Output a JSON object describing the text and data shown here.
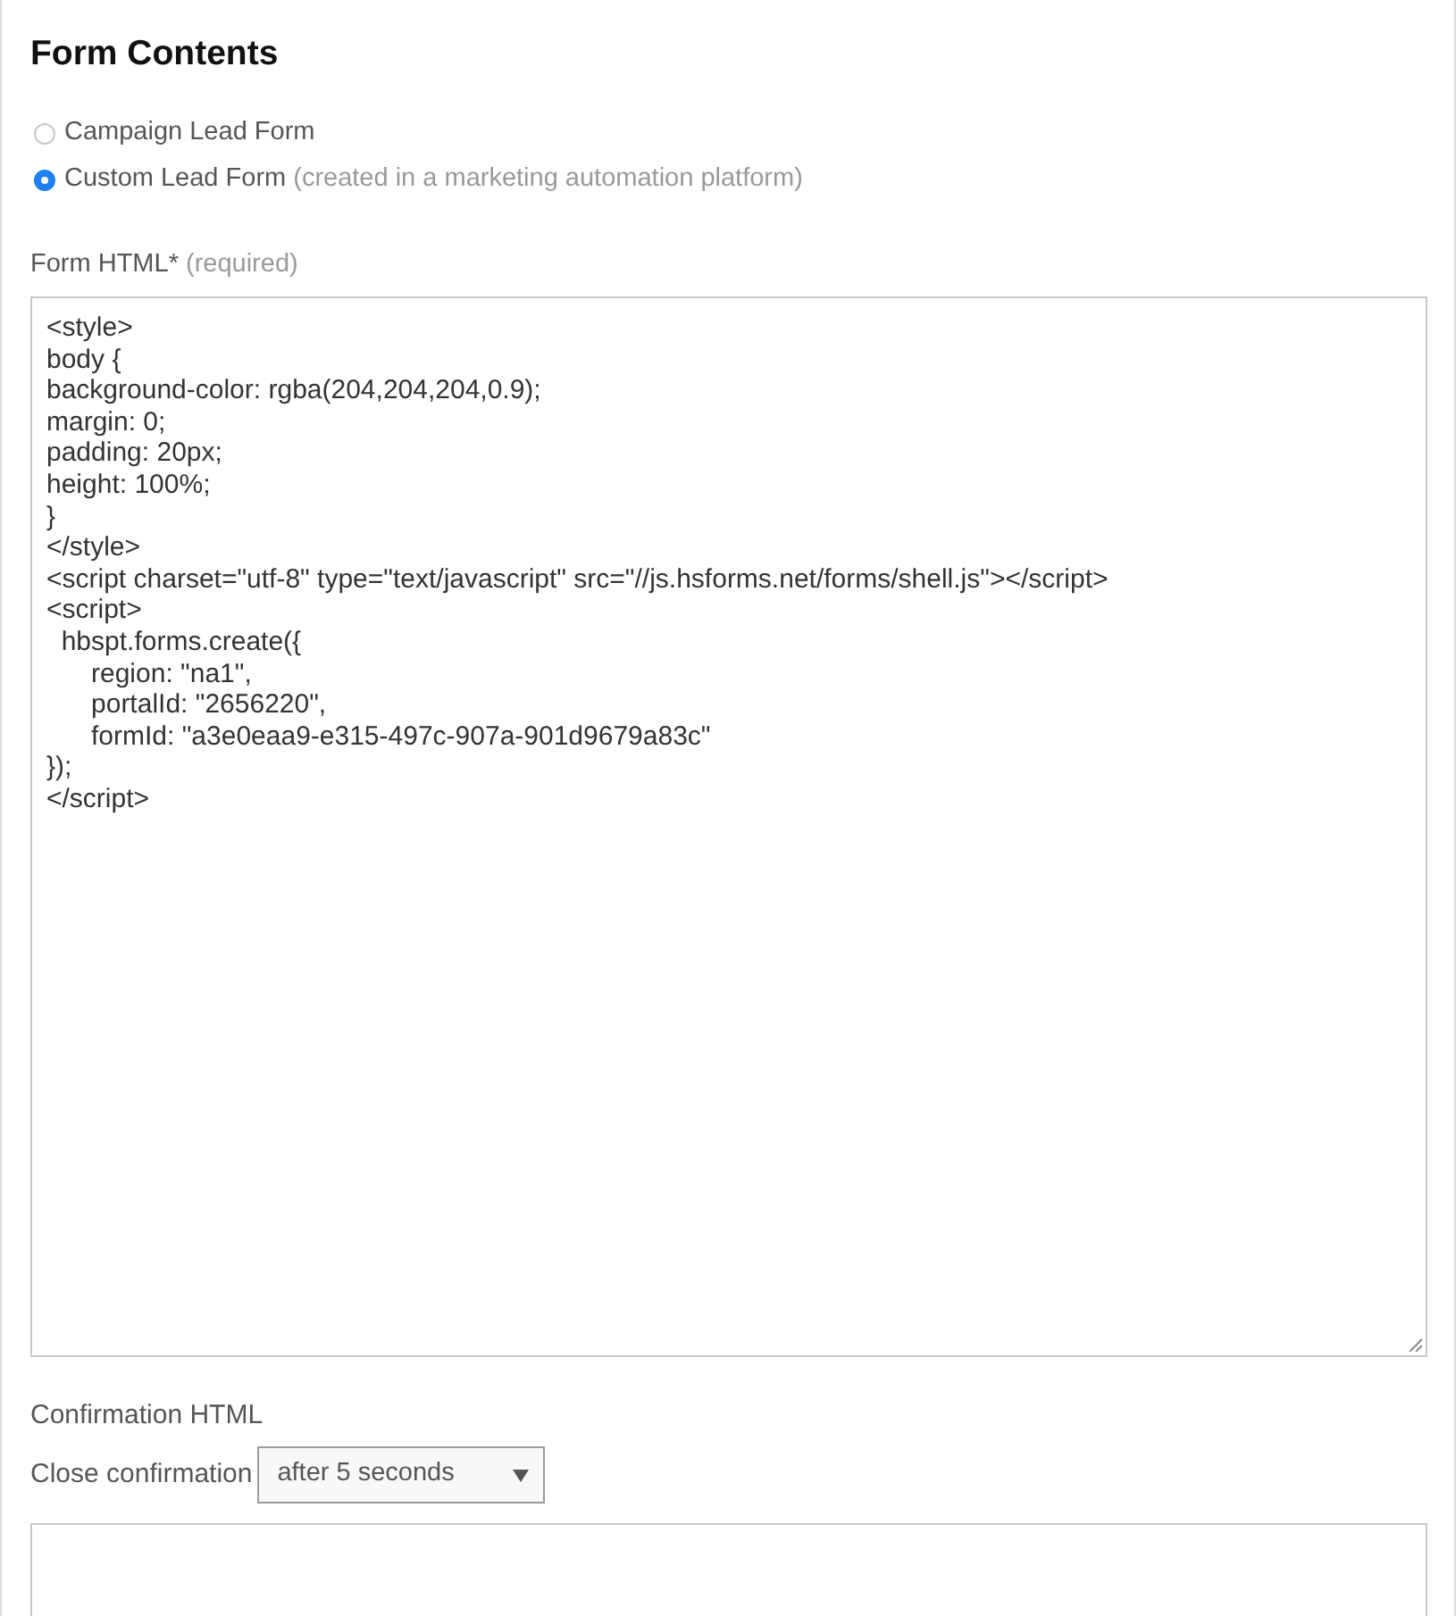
{
  "section": {
    "title": "Form Contents"
  },
  "form_type_options": [
    {
      "label": "Campaign Lead Form",
      "selected": false
    },
    {
      "label": "Custom Lead Form",
      "hint": "(created in a marketing automation platform)",
      "selected": true
    }
  ],
  "form_html": {
    "label": "Form HTML*",
    "hint": "(required)",
    "value": "<style>\nbody {\nbackground-color: rgba(204,204,204,0.9);\nmargin: 0;\npadding: 20px;\nheight: 100%;\n}\n</style>\n<script charset=\"utf-8\" type=\"text/javascript\" src=\"//js.hsforms.net/forms/shell.js\"></script>\n<script>\n  hbspt.forms.create({\n      region: \"na1\",\n      portalId: \"2656220\",\n      formId: \"a3e0eaa9-e315-497c-907a-901d9679a83c\"\n});\n</script>"
  },
  "confirmation_html": {
    "label": "Confirmation HTML",
    "close_confirmation": {
      "label": "Close confirmation",
      "value": "after 5 seconds"
    }
  }
}
